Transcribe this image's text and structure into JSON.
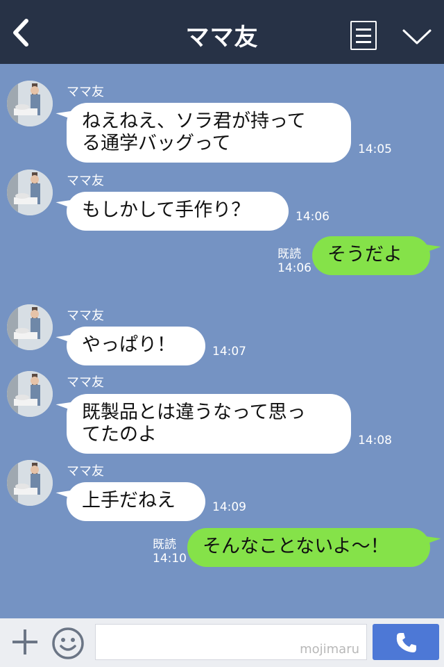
{
  "header": {
    "title": "ママ友"
  },
  "messages": [
    {
      "sender": "ママ友",
      "text": "ねえねえ、ソラ君が持って\nる通学バッグって",
      "time": "14:05"
    },
    {
      "sender": "ママ友",
      "text": "もしかして手作り？",
      "time": "14:06"
    },
    {
      "text": "そうだよ",
      "read": "既読",
      "time": "14:06"
    },
    {
      "sender": "ママ友",
      "text": "やっぱり！",
      "time": "14:07"
    },
    {
      "sender": "ママ友",
      "text": "既製品とは違うなって思っ\nてたのよ",
      "time": "14:08"
    },
    {
      "sender": "ママ友",
      "text": "上手だねえ",
      "time": "14:09"
    },
    {
      "text": "そんなことないよ〜！",
      "read": "既読",
      "time": "14:10"
    }
  ],
  "footer": {
    "watermark": "mojimaru"
  },
  "colors": {
    "header_bg": "#273246",
    "chat_bg": "#7593c3",
    "incoming_bubble": "#ffffff",
    "outgoing_bubble": "#85e249",
    "call_button": "#4d78d6"
  },
  "icons": {
    "back": "back-chevron-icon",
    "menu": "list-menu-icon",
    "collapse": "chevron-down-icon",
    "add": "plus-icon",
    "sticker": "smiley-icon",
    "call": "phone-icon"
  }
}
